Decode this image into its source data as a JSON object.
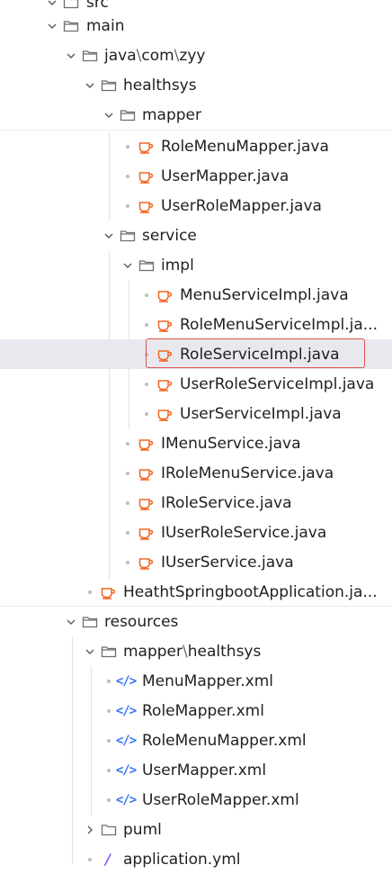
{
  "tree": {
    "top_partial": "src",
    "main": "main",
    "java_path": [
      "java",
      "com",
      "zyy"
    ],
    "healthsys": "healthsys",
    "mapper_folder": "mapper",
    "mapper_files": [
      "RoleMenuMapper.java",
      "UserMapper.java",
      "UserRoleMapper.java"
    ],
    "service_folder": "service",
    "impl_folder": "impl",
    "impl_files": [
      "MenuServiceImpl.java",
      "RoleMenuServiceImpl.ja...",
      "RoleServiceImpl.java",
      "UserRoleServiceImpl.java",
      "UserServiceImpl.java"
    ],
    "service_files": [
      "IMenuService.java",
      "IRoleMenuService.java",
      "IRoleService.java",
      "IUserRoleService.java",
      "IUserService.java"
    ],
    "application_file": "HeathtSpringbootApplication.ja...",
    "resources_folder": "resources",
    "mapper_healthsys": [
      "mapper",
      "healthsys"
    ],
    "xml_files": [
      "MenuMapper.xml",
      "RoleMapper.xml",
      "RoleMenuMapper.xml",
      "UserMapper.xml",
      "UserRoleMapper.xml"
    ],
    "puml_folder": "puml",
    "application_yml": "application.yml",
    "selected_file": "RoleServiceImpl.java"
  },
  "colors": {
    "java_icon": "#f26522",
    "folder_icon": "#6e6e6e",
    "xml_icon": "#3574f0",
    "yml_icon": "#8b5cf6",
    "selection_border": "#e0504e",
    "selection_bg": "#e8e9ee"
  },
  "icons": {
    "folder": "folder-icon",
    "java": "java-coffee-icon",
    "xml": "xml-icon",
    "yml": "yaml-icon",
    "expand": "chevron-down-icon",
    "collapse": "chevron-right-icon"
  }
}
